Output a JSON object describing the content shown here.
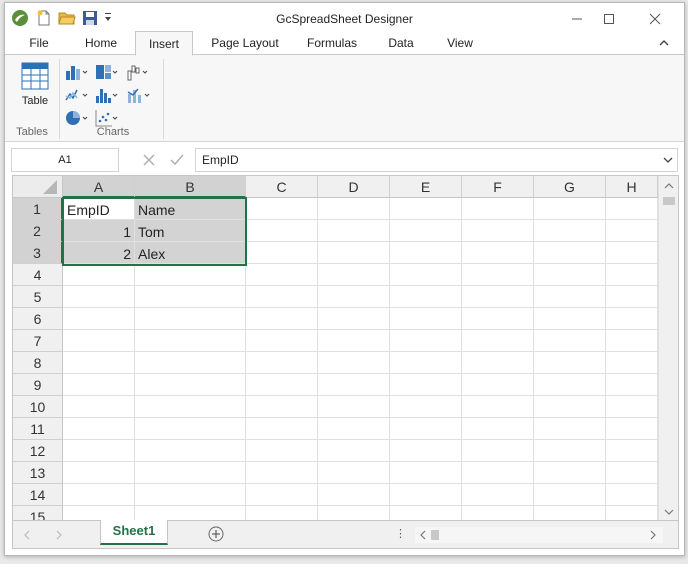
{
  "window": {
    "title": "GcSpreadSheet Designer"
  },
  "quick_access": [
    {
      "icon": "app-logo-icon"
    },
    {
      "icon": "new-file-icon"
    },
    {
      "icon": "open-folder-icon"
    },
    {
      "icon": "save-icon"
    },
    {
      "icon": "customize-dropdown-icon"
    }
  ],
  "tabs": [
    {
      "label": "File",
      "active": false
    },
    {
      "label": "Home",
      "active": false
    },
    {
      "label": "Insert",
      "active": true
    },
    {
      "label": "Page Layout",
      "active": false
    },
    {
      "label": "Formulas",
      "active": false
    },
    {
      "label": "Data",
      "active": false
    },
    {
      "label": "View",
      "active": false
    }
  ],
  "ribbon": {
    "table_button_label": "Table",
    "groups": [
      {
        "label": "Tables"
      },
      {
        "label": "Charts"
      }
    ]
  },
  "formula_bar": {
    "name_box": "A1",
    "formula": "EmpID"
  },
  "grid": {
    "columns": [
      "A",
      "B",
      "C",
      "D",
      "E",
      "F",
      "G",
      "H"
    ],
    "rows": [
      "1",
      "2",
      "3",
      "4",
      "5",
      "6",
      "7",
      "8",
      "9",
      "10",
      "11",
      "12",
      "13",
      "14",
      "15"
    ],
    "cells": {
      "A1": "EmpID",
      "B1": "Name",
      "A2": "1",
      "B2": "Tom",
      "A3": "2",
      "B3": "Alex"
    },
    "selection": "A1:B3"
  },
  "sheet_tabs": [
    {
      "label": "Sheet1",
      "active": true
    }
  ],
  "colors": {
    "accent": "#217346",
    "selection_fill": "#d3d3d3",
    "header_bg": "#f0f0f0"
  }
}
